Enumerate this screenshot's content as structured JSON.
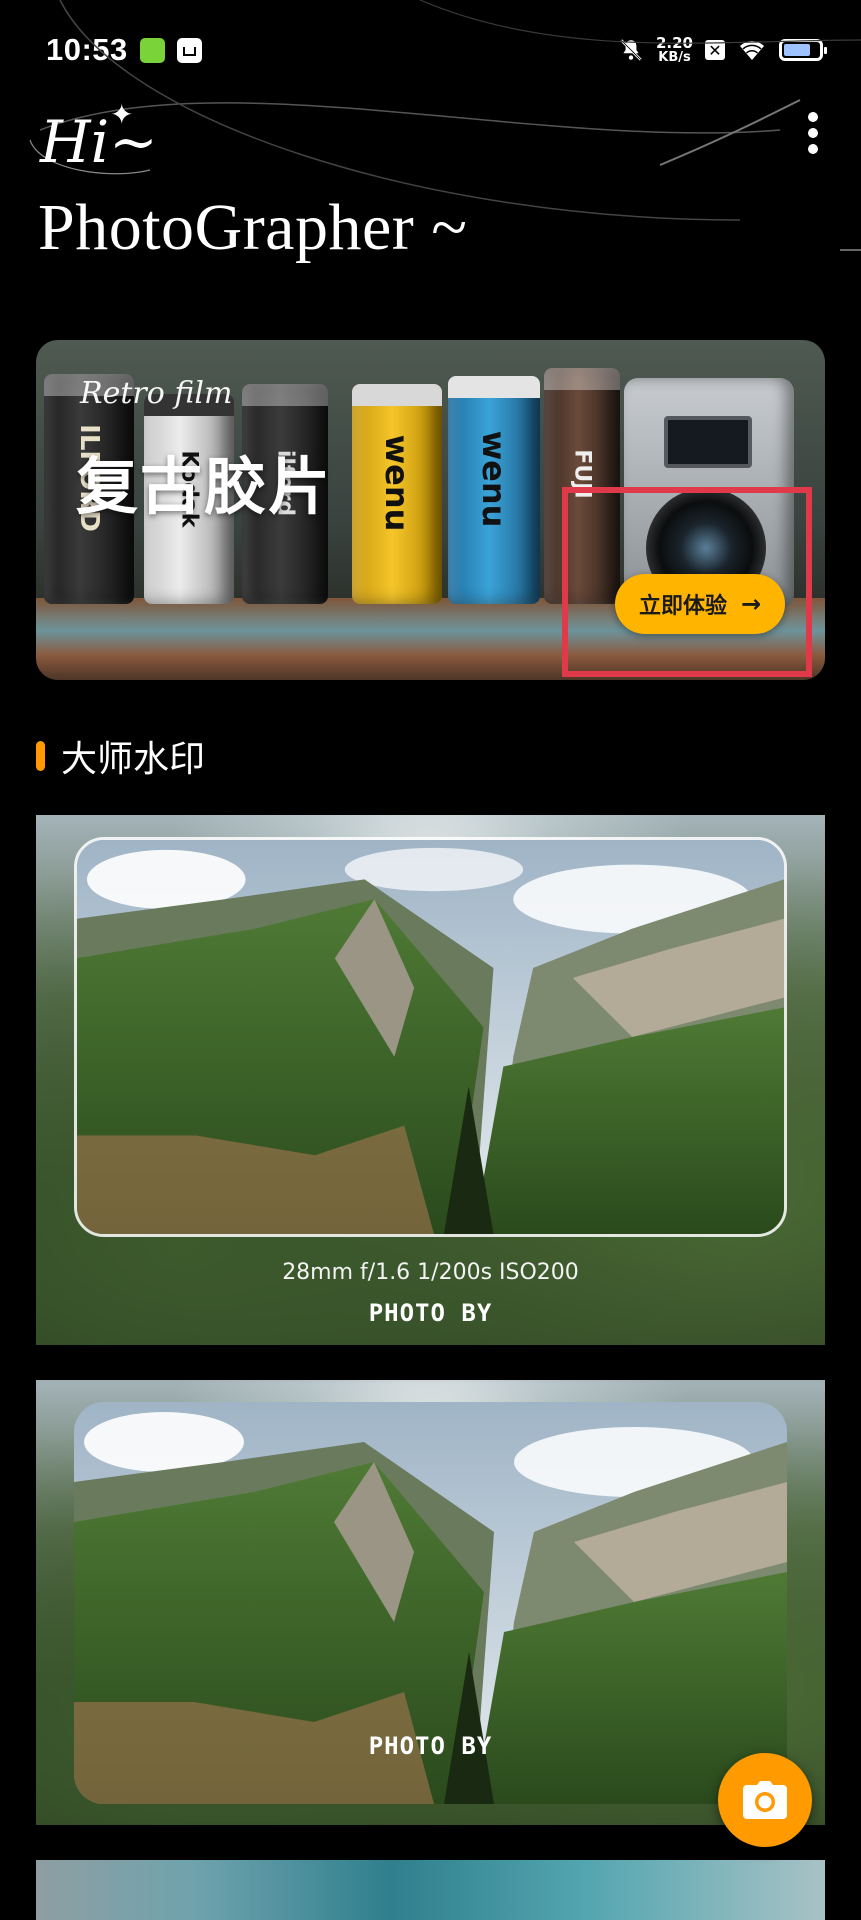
{
  "status_bar": {
    "time": "10:53",
    "net_speed_value": "2.20",
    "net_speed_unit": "KB/s",
    "icons": [
      "green-app-icon",
      "inbox-icon",
      "mute-icon",
      "sim-off-icon",
      "wifi-icon",
      "battery-icon"
    ],
    "battery_level": 0.75
  },
  "header": {
    "greeting_hi": "Hi~",
    "greeting_main": "PhotoGrapher ~"
  },
  "banner": {
    "subtitle": "Retro film",
    "title": "复古胶片",
    "button_label": "立即体验",
    "button_arrow": "→",
    "can_labels": [
      "ILFORD",
      "Kodak",
      "ilford",
      "wenu",
      "wenu",
      "FUJI"
    ],
    "highlight_color": "#e0394a"
  },
  "section": {
    "title": "大师水印",
    "accent_color": "#ff9a00"
  },
  "watermark_cards": [
    {
      "exif": "28mm  f/1.6  1/200s  ISO200",
      "photo_by": "PHOTO BY"
    },
    {
      "exif": "",
      "photo_by": "PHOTO BY"
    }
  ],
  "fab": {
    "icon": "camera-icon",
    "color": "#ff9a00"
  }
}
